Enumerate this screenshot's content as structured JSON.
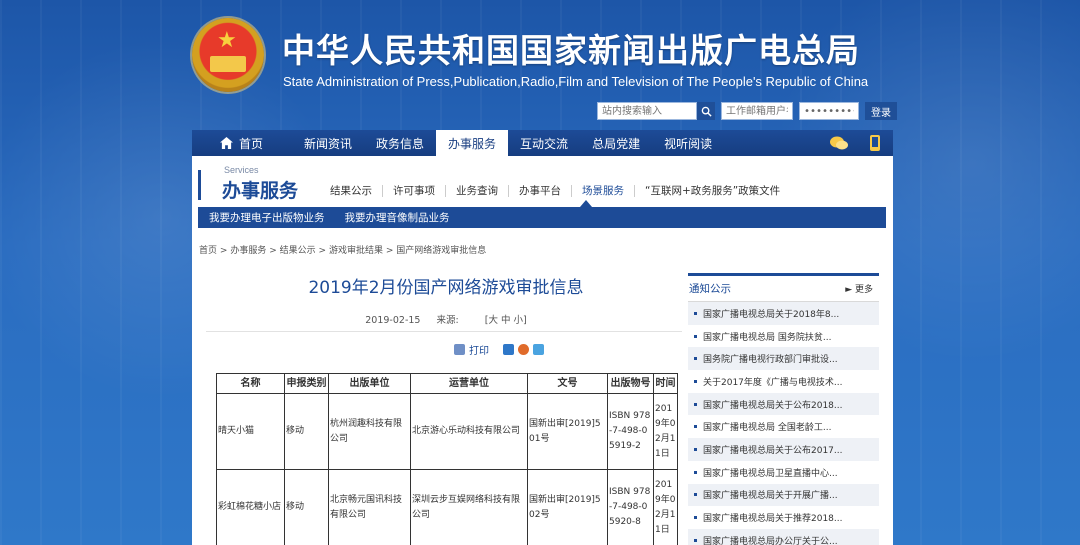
{
  "header": {
    "title_cn": "中华人民共和国国家新闻出版广电总局",
    "title_en": "State Administration of Press,Publication,Radio,Film and Television of The People's Republic of China"
  },
  "search": {
    "site_placeholder": "站内搜索输入",
    "email_placeholder": "工作邮箱用户名",
    "password_value": "•••••••••",
    "login_label": "登录"
  },
  "nav": {
    "items": [
      "首页",
      "新闻资讯",
      "政务信息",
      "办事服务",
      "互动交流",
      "总局党建",
      "视听阅读"
    ],
    "active_index": 3
  },
  "section": {
    "en": "Services",
    "cn": "办事服务",
    "sub_nav": [
      "结果公示",
      "许可事项",
      "业务查询",
      "办事平台",
      "场景服务",
      "“互联网+政务服务”政策文件"
    ],
    "sub_nav_active": 4,
    "sub_bar": [
      "我要办理电子出版物业务",
      "我要办理音像制品业务"
    ]
  },
  "breadcrumb": [
    "首页",
    "办事服务",
    "结果公示",
    "游戏审批结果",
    "国产网络游戏审批信息"
  ],
  "breadcrumb_sep": ">",
  "article": {
    "title": "2019年2月份国产网络游戏审批信息",
    "date": "2019-02-15",
    "source_label": "来源:",
    "size_label": "[大 中 小]",
    "print_label": "打印"
  },
  "table": {
    "headers": [
      "名称",
      "申报类别",
      "出版单位",
      "运营单位",
      "文号",
      "出版物号",
      "时间"
    ],
    "rows": [
      [
        "晴天小猫",
        "移动",
        "杭州润趣科技有限公司",
        "北京游心乐动科技有限公司",
        "国新出审[2019]501号",
        "ISBN 978-7-498-05919-2",
        "2019年02月11日"
      ],
      [
        "彩虹棉花糖小店",
        "移动",
        "北京畅元国讯科技有限公司",
        "深圳云步互娱网络科技有限公司",
        "国新出审[2019]502号",
        "ISBN 978-7-498-05920-8",
        "2019年02月11日"
      ]
    ]
  },
  "sidebar": {
    "title": "通知公示",
    "more": "► 更多",
    "items": [
      "国家广播电视总局关于2018年8...",
      "国家广播电视总局 国务院扶贫...",
      "国务院广播电视行政部门审批设...",
      "关于2017年度《广播与电视技术...",
      "国家广播电视总局关于公布2018...",
      "国家广播电视总局 全国老龄工...",
      "国家广播电视总局关于公布2017...",
      "国家广播电视总局卫星直播中心...",
      "国家广播电视总局关于开展广播...",
      "国家广播电视总局关于推荐2018...",
      "国家广播电视总局办公厅关于公..."
    ]
  },
  "colors": {
    "primary": "#1d4b97",
    "background": "#2a6cc0"
  },
  "icons": {
    "home": "home-icon",
    "search": "search-icon",
    "wechat": "wechat-icon",
    "mobile": "mobile-icon",
    "print": "print-icon"
  }
}
